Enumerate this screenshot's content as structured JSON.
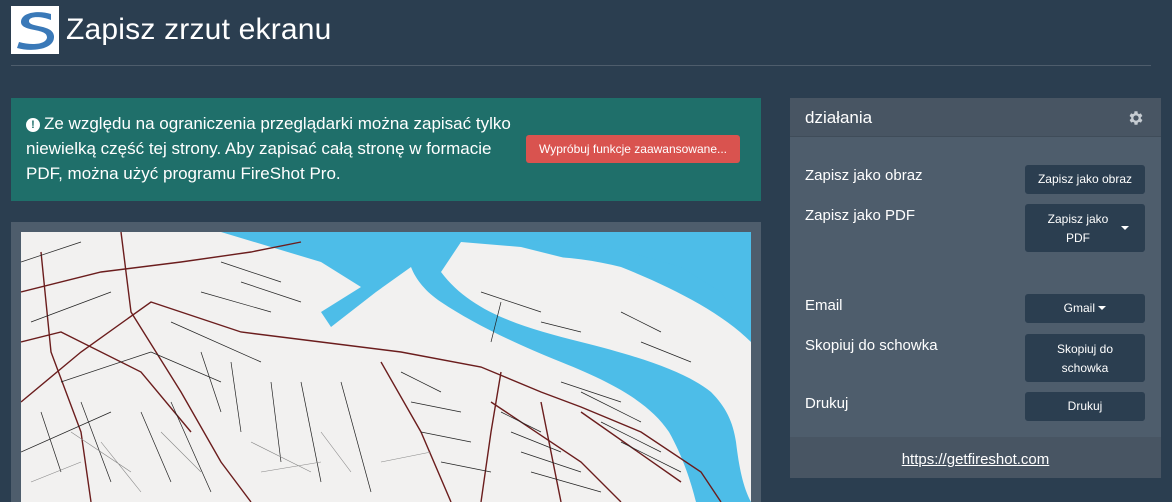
{
  "header": {
    "title": "Zapisz zrzut ekranu",
    "logo_icon": "fireshot-logo"
  },
  "alert": {
    "icon": "exclamation-circle-icon",
    "text": "Ze względu na ograniczenia przeglądarki można zapisać tylko niewielką część tej strony. Aby zapisać całą stronę w formacie PDF, można użyć programu FireShot Pro.",
    "button_label": "Wypróbuj funkcje zaawansowane..."
  },
  "preview": {
    "content": "map-screenshot"
  },
  "panel": {
    "title": "działania",
    "settings_icon": "gear-icon",
    "actions": [
      {
        "label": "Zapisz jako obraz",
        "button": "Zapisz jako obraz"
      },
      {
        "label": "Zapisz jako PDF",
        "button": "Zapisz jako PDF"
      },
      {
        "label": "Email",
        "button": "Gmail"
      },
      {
        "label": "Skopiuj do schowka",
        "button": "Skopiuj do schowka"
      },
      {
        "label": "Drukuj",
        "button": "Drukuj"
      }
    ],
    "footer_link": "https://getfireshot.com"
  },
  "colors": {
    "background": "#2b3e50",
    "alert": "#1f6f6a",
    "danger_button": "#d9534f",
    "panel": "#4e5d6c",
    "water": "#4dbde8"
  }
}
